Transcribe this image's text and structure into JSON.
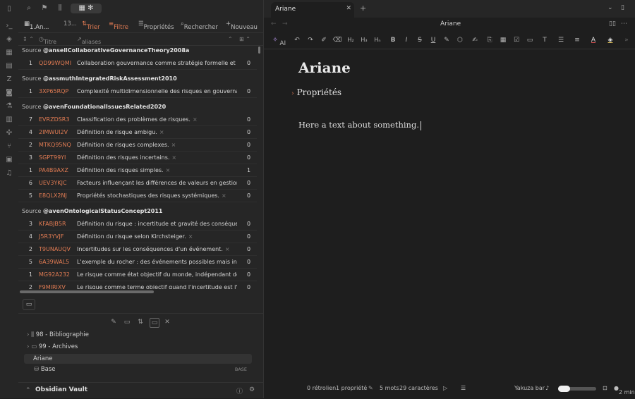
{
  "left_top": {
    "active_label": "1.An...",
    "tab_count": "13..."
  },
  "toolbar": {
    "sort": "Trier",
    "filter": "Filtre",
    "properties": "Propriétés",
    "search": "Rechercher",
    "new": "Nouveau"
  },
  "columns": {
    "title": "Titre",
    "aliases": "aliases"
  },
  "groups": [
    {
      "prefix": "Source",
      "name": "@ansellCollaborativeGovernanceTheory2008a",
      "rows": [
        {
          "n": "1",
          "id": "QD99WQMI",
          "text": "Collaboration gouvernance comme stratégie formelle et organisationnelle",
          "v": "0",
          "x": false
        }
      ]
    },
    {
      "prefix": "Source",
      "name": "@assmuthIntegratedRiskAssessment2010",
      "rows": [
        {
          "n": "1",
          "id": "3XP65RQP",
          "text": "Complexité multidimensionnelle des risques en gouvernance.",
          "v": "0",
          "x": true
        }
      ]
    },
    {
      "prefix": "Source",
      "name": "@avenFoundationalIssuesRelated2020",
      "rows": [
        {
          "n": "7",
          "id": "EVRZDSR3",
          "text": "Classification des problèmes de risques.",
          "v": "0",
          "x": true
        },
        {
          "n": "4",
          "id": "2IMWUI2V",
          "text": "Définition de risque ambigu.",
          "v": "0",
          "x": true
        },
        {
          "n": "2",
          "id": "MTKQ95NQ",
          "text": "Définition de risques complexes.",
          "v": "0",
          "x": true
        },
        {
          "n": "3",
          "id": "SGPT99YI",
          "text": "Définition des risques incertains.",
          "v": "0",
          "x": true
        },
        {
          "n": "1",
          "id": "PA4B9AXZ",
          "text": "Définition des risques simples.",
          "v": "1",
          "x": true
        },
        {
          "n": "6",
          "id": "UEV3YKJC",
          "text": "Facteurs influençant les différences de valeurs en gestion des risques",
          "v": "0",
          "x": false
        },
        {
          "n": "5",
          "id": "E8QLX2NJ",
          "text": "Propriétés stochastiques des risques systémiques.",
          "v": "0",
          "x": true
        }
      ]
    },
    {
      "prefix": "Source",
      "name": "@avenOntologicalStatusConcept2011",
      "rows": [
        {
          "n": "3",
          "id": "KFABJB5R",
          "text": "Définition du risque : incertitude et gravité des conséquences.",
          "v": "0",
          "x": false
        },
        {
          "n": "4",
          "id": "J5R3YVJF",
          "text": "Définition du risque selon Kirchsteiger.",
          "v": "0",
          "x": true
        },
        {
          "n": "2",
          "id": "T9UNAUQV",
          "text": "Incertitudes sur les conséquences d'un événement.",
          "v": "0",
          "x": true
        },
        {
          "n": "5",
          "id": "6A39WAL5",
          "text": "L'exemple du rocher : des événements possibles mais incertains",
          "v": "0",
          "x": false
        },
        {
          "n": "1",
          "id": "MG92A232",
          "text": "Le risque comme état objectif du monde, indépendant de nos perceptions",
          "v": "0",
          "x": false
        },
        {
          "n": "2",
          "id": "F9MIRJXV",
          "text": "Le risque comme terme objectif quand l'incertitude est l'inconnu",
          "v": "0",
          "x": false
        }
      ]
    }
  ],
  "tree": [
    {
      "label": "98 - Bibliographie",
      "kind": "folder"
    },
    {
      "label": "99 - Archives",
      "kind": "folder"
    },
    {
      "label": "Ariane",
      "kind": "file",
      "active": true
    },
    {
      "label": "Base",
      "kind": "base",
      "badge": "BASE"
    }
  ],
  "vault_name": "Obsidian Vault",
  "tab": {
    "label": "Ariane"
  },
  "note": {
    "title": "Ariane",
    "header": "Ariane",
    "properties_label": "Propriétés",
    "body": "Here a text about something."
  },
  "fmt": {
    "ai": "AI"
  },
  "status": {
    "backlinks": "0 rétrolien",
    "props": "1 propriété",
    "words": "5 mots",
    "chars": "29 caractères",
    "theme": "Yakuza bar",
    "read_time": "2 min"
  },
  "colors": {
    "accent": "#e07b53",
    "text": "#dadada",
    "bg": "#1e1e1e",
    "panel": "#262626"
  }
}
